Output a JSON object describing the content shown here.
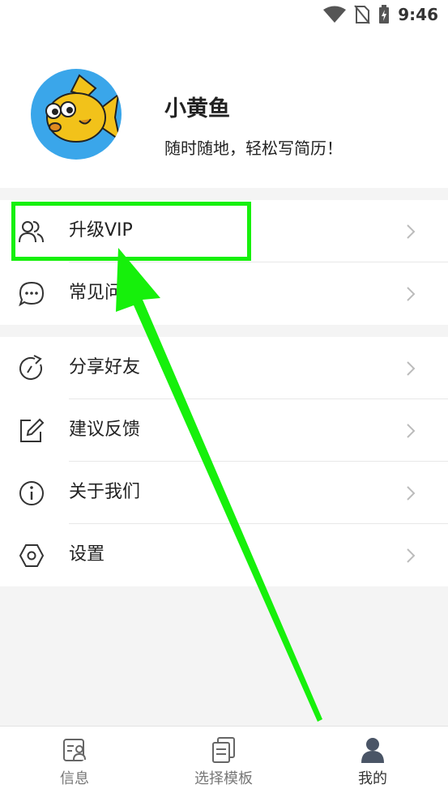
{
  "status": {
    "time": "9:46"
  },
  "profile": {
    "name": "小黄鱼",
    "slogan": "随时随地，轻松写简历！"
  },
  "menu_group_1": [
    {
      "label": "升级VIP",
      "icon": "users-icon"
    },
    {
      "label": "常见问题",
      "icon": "chat-icon"
    }
  ],
  "menu_group_2": [
    {
      "label": "分享好友",
      "icon": "share-icon"
    },
    {
      "label": "建议反馈",
      "icon": "edit-icon"
    },
    {
      "label": "关于我们",
      "icon": "info-icon"
    },
    {
      "label": "设置",
      "icon": "settings-icon"
    }
  ],
  "tabs": [
    {
      "label": "信息",
      "icon": "profile-card-icon"
    },
    {
      "label": "选择模板",
      "icon": "templates-icon"
    },
    {
      "label": "我的",
      "icon": "user-icon",
      "active": true
    }
  ],
  "colors": {
    "highlight": "#16f00b",
    "avatar_bg": "#3aa6ea"
  }
}
